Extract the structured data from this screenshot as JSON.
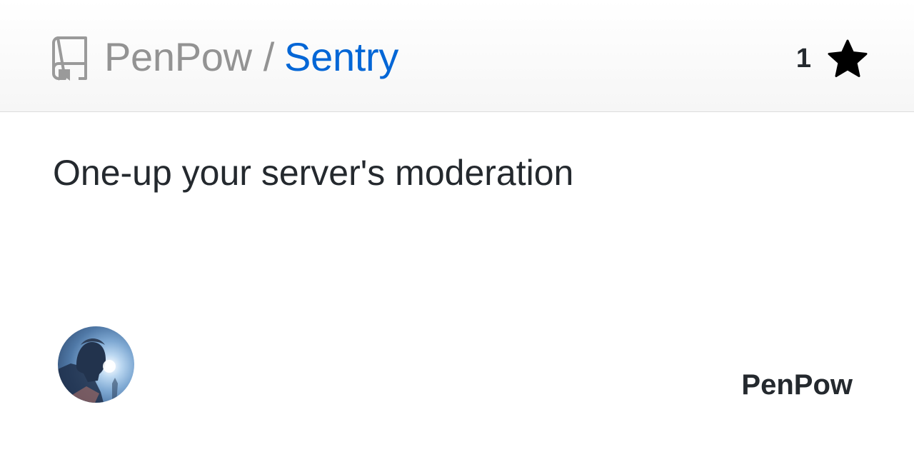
{
  "header": {
    "owner": "PenPow",
    "separator": "/",
    "repo": "Sentry",
    "star_count": "1",
    "icons": {
      "repo": "repo-book-icon",
      "star": "star-icon"
    }
  },
  "description": "One-up your server's moderation",
  "footer": {
    "author": "PenPow",
    "avatar_icon": "avatar"
  },
  "colors": {
    "owner": "#939393",
    "repo_link": "#0366d6",
    "text": "#24292e",
    "header_bg": "#f6f6f6",
    "divider": "#dddddd"
  }
}
